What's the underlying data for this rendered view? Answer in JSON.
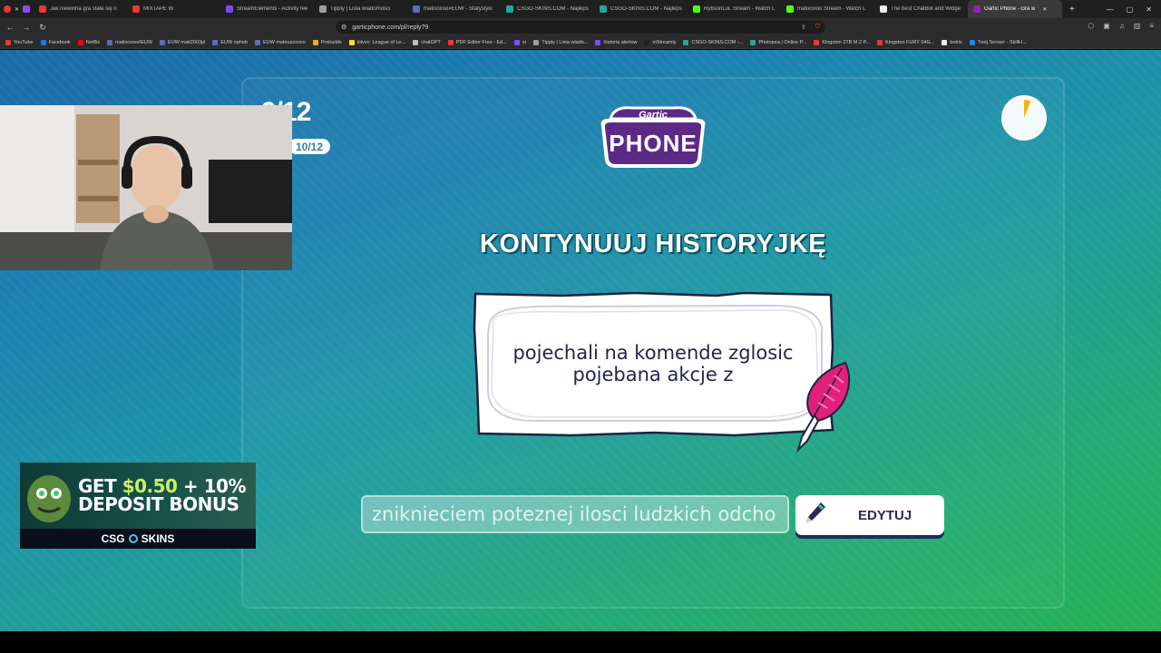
{
  "browser": {
    "tabs": [
      {
        "label": "Jak niewinna gra stała się n",
        "color": "#e53935"
      },
      {
        "label": "MIXTAPE W",
        "color": "#e53935"
      },
      {
        "label": "StreamElements - Activity fee",
        "color": "#7c4dff"
      },
      {
        "label": "Tipply | Lista wiadomości",
        "color": "#9e9e9e"
      },
      {
        "label": "matixoxoo#EUW - Statystyki",
        "color": "#5c6bc0"
      },
      {
        "label": "CSGO-SKINS.COM - Najlepsz",
        "color": "#26a69a"
      },
      {
        "label": "CSGO-SKINS.COM - Najlepsz",
        "color": "#26a69a"
      },
      {
        "label": "RybsonLoL Stream - Watch L",
        "color": "#53fc18"
      },
      {
        "label": "matixoxoo Stream - Watch L",
        "color": "#53fc18"
      },
      {
        "label": "The best ChatBot and Widge",
        "color": "#eeeeee"
      },
      {
        "label": "Gartic Phone - Gra w",
        "color": "#8e24aa",
        "active": true
      }
    ],
    "url": "garticphone.com/pl/reply?9",
    "bookmarks": [
      {
        "label": "YouTube",
        "color": "#e53935"
      },
      {
        "label": "Facebook",
        "color": "#1877f2"
      },
      {
        "label": "Netflix",
        "color": "#e50914"
      },
      {
        "label": "matixoxoo#EUW",
        "color": "#5c6bc0"
      },
      {
        "label": "EUW mati2003pl",
        "color": "#5c6bc0"
      },
      {
        "label": "EUW ophob",
        "color": "#5c6bc0"
      },
      {
        "label": "EUW mateuszxoxo",
        "color": "#5c6bc0"
      },
      {
        "label": "Probuilds",
        "color": "#f9a825"
      },
      {
        "label": "lolvvv: League of Le...",
        "color": "#fdd835"
      },
      {
        "label": "chatGPT",
        "color": "#bdbdbd"
      },
      {
        "label": "PDF Editor Free - Ed...",
        "color": "#e53935"
      },
      {
        "label": "sr",
        "color": "#7c4dff"
      },
      {
        "label": "Tipply | Lista wiado...",
        "color": "#9e9e9e"
      },
      {
        "label": "historia alertow",
        "color": "#7c4dff"
      },
      {
        "label": "inStreamly",
        "color": "#212121"
      },
      {
        "label": "CSGO-SKINS.COM -...",
        "color": "#26a69a"
      },
      {
        "label": "Photopea | Online P...",
        "color": "#26a69a"
      },
      {
        "label": "Kingston 2TB M.2 P...",
        "color": "#e53935"
      },
      {
        "label": "Kingston FURY 64G...",
        "color": "#e53935"
      },
      {
        "label": "botrix",
        "color": "#eeeeee"
      },
      {
        "label": "Twój Serwer - SkillH...",
        "color": "#1e88e5"
      }
    ]
  },
  "game": {
    "round": "9/12",
    "done_count": "10/12",
    "logo_top": "Gartic",
    "logo_bottom": "PHONE",
    "heading": "KONTYNUUJ HISTORYJKĘ",
    "prompt_line1": "pojechali na komende zglosic",
    "prompt_line2": "pojebana akcje z",
    "answer": "zniknieciem poteznej ilosci ludzkich odcho",
    "edit_label": "EDYTUJ",
    "timer_progress": 0.06
  },
  "overlay": {
    "ad_line1_a": "GET ",
    "ad_line1_b": "$0.50",
    "ad_line1_c": " + 10%",
    "ad_line2": "DEPOSIT BONUS",
    "ad_brand_a": "CSG",
    "ad_brand_b": "SKINS"
  }
}
